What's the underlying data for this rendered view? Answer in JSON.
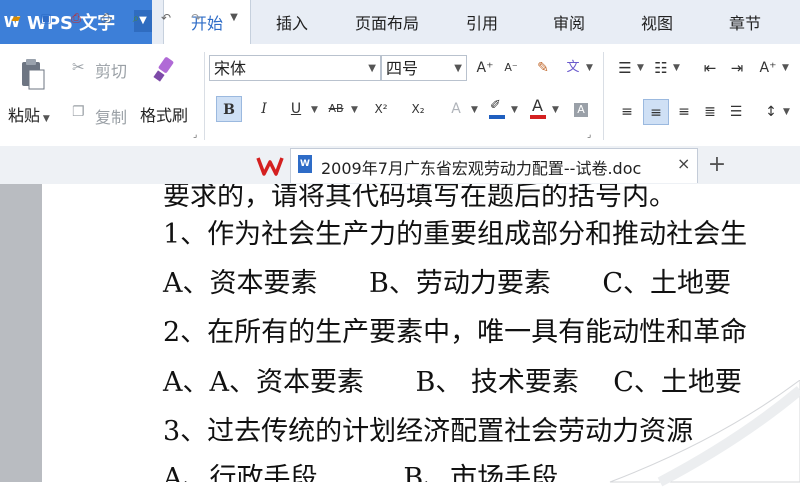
{
  "app": {
    "name": "WPS 文字",
    "logo": "W"
  },
  "menu": {
    "tabs": [
      "开始",
      "插入",
      "页面布局",
      "引用",
      "审阅",
      "视图",
      "章节"
    ],
    "active": "开始"
  },
  "ribbon": {
    "paste": "粘贴",
    "cut": "剪切",
    "copy": "复制",
    "format_painter": "格式刷",
    "font_name": "宋体",
    "font_size": "四号",
    "bold": "B",
    "italic": "I",
    "underline": "U",
    "strike": "AB",
    "superscript": "X²",
    "subscript": "X₂",
    "grow_font": "A⁺",
    "shrink_font": "A⁻",
    "font_color": "A",
    "highlight_color": "#1f5fbf",
    "font_color_bar": "#d42020"
  },
  "document_tab": {
    "title": "2009年7月广东省宏观劳动力配置--试卷.doc",
    "icon": "W",
    "close": "×"
  },
  "add_tab": "+",
  "document": {
    "lines": [
      "要求的，请将其代码填写在题后的括号内。",
      "1、作为社会生产力的重要组成部分和推动社会生",
      "A、资本要素      B、劳动力要素      C、土地要",
      "2、在所有的生产要素中，唯一具有能动性和革命",
      "A、A、资本要素      B、 技术要素    C、土地要",
      "3、过去传统的计划经济配置社会劳动力资源",
      "A、行政手段          B、市场手段"
    ]
  }
}
